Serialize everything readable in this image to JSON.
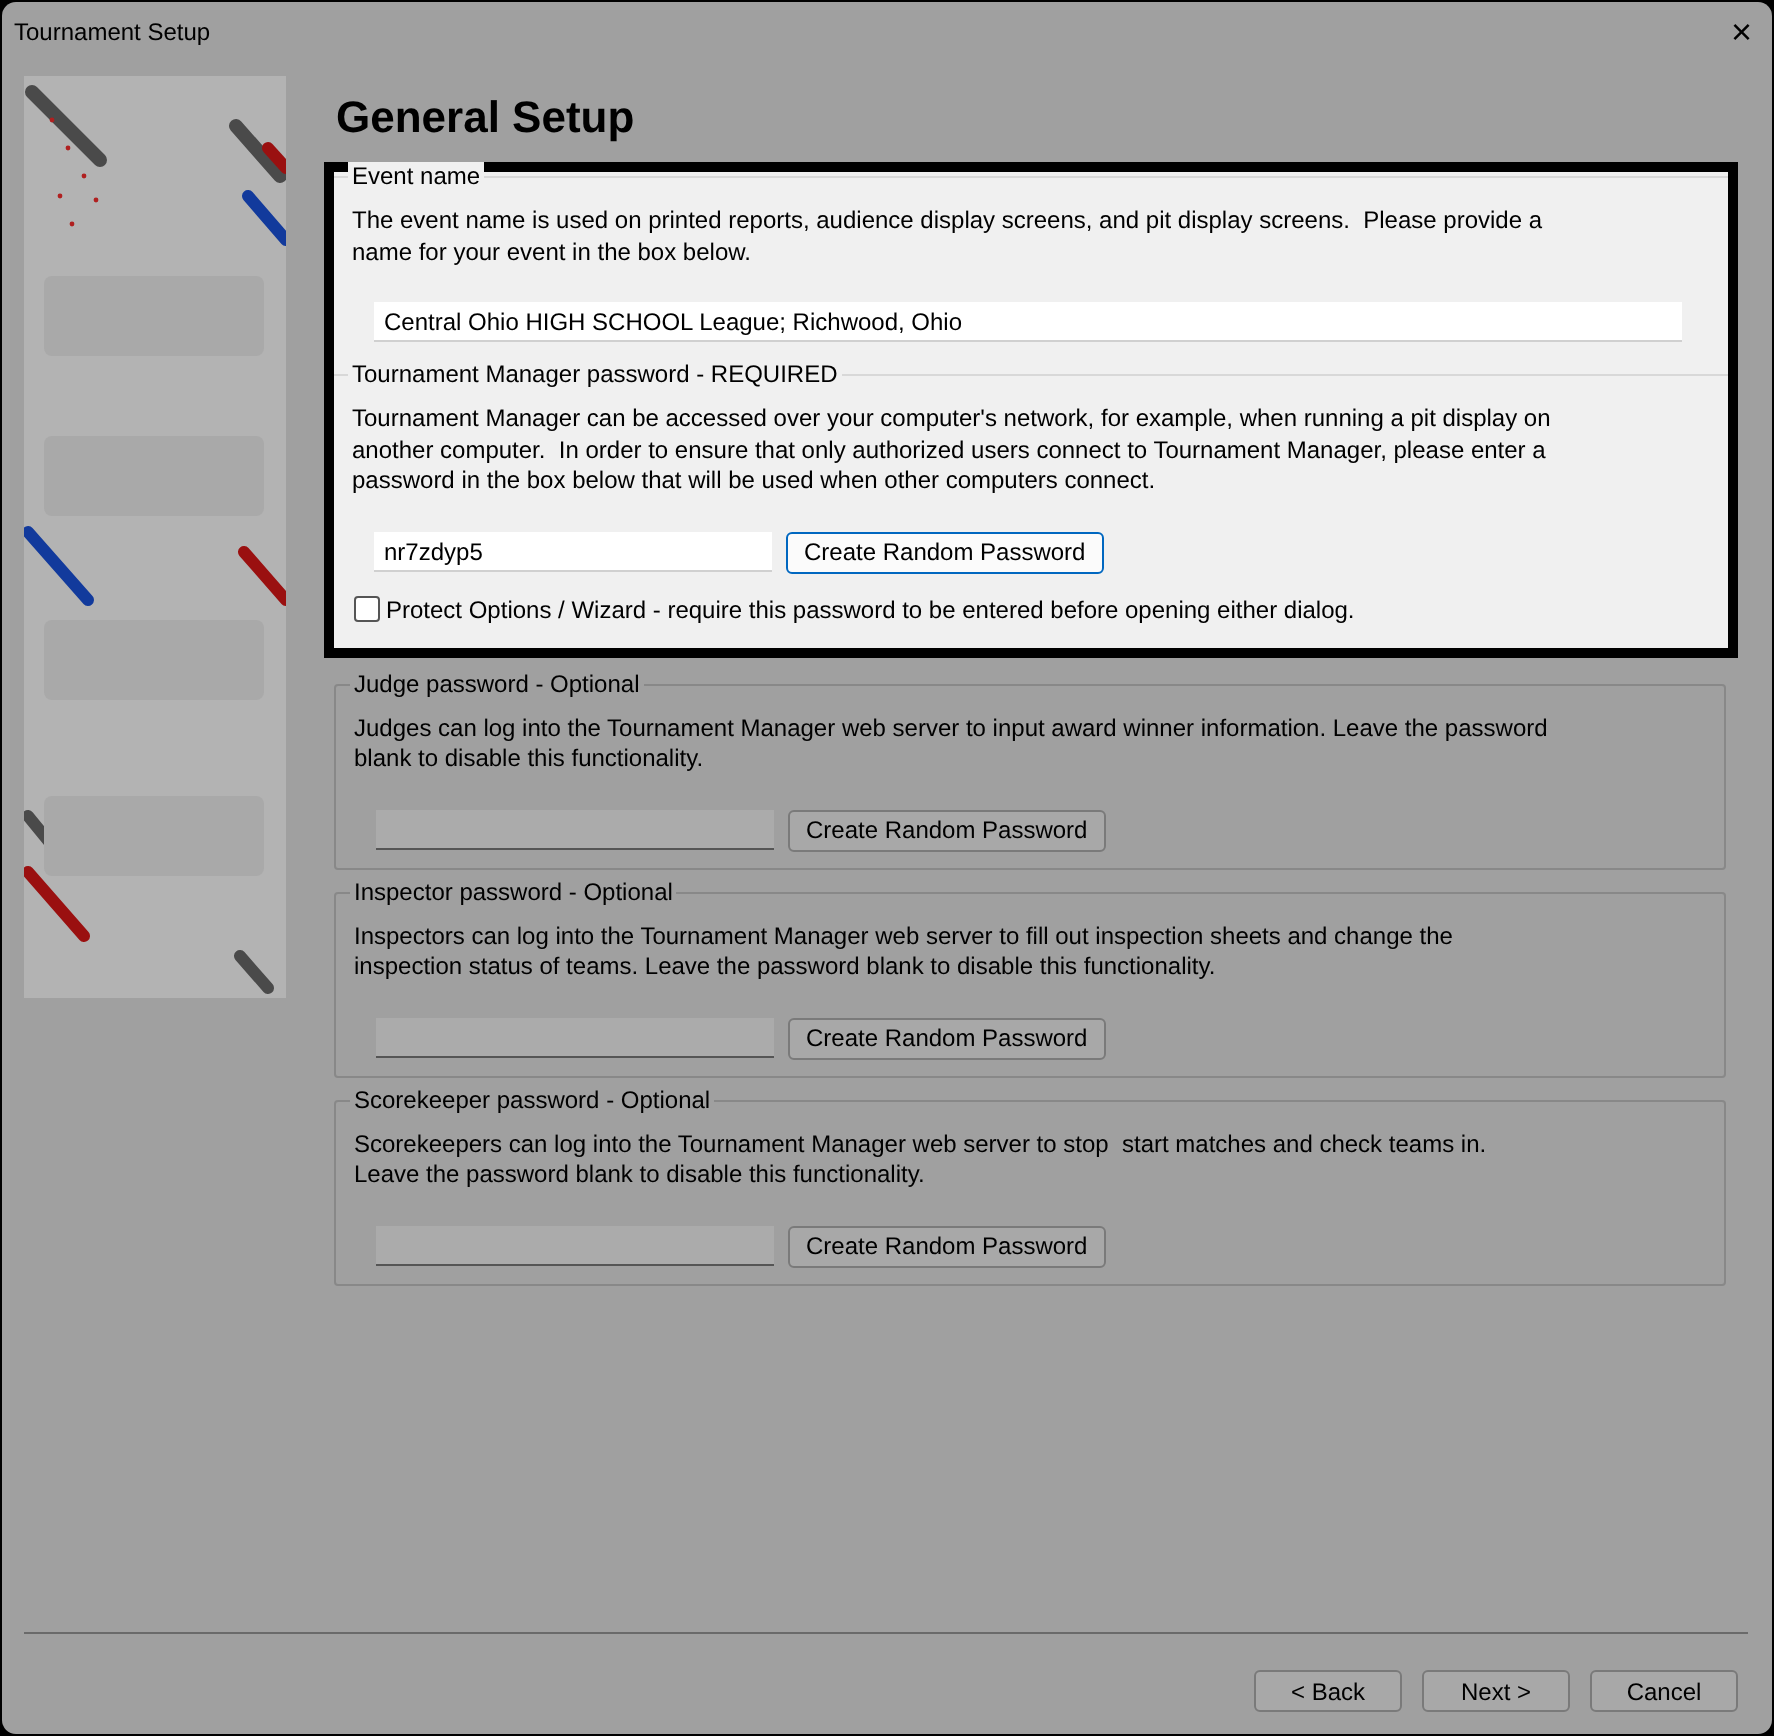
{
  "window": {
    "title": "Tournament Setup",
    "close": "×"
  },
  "heading": "General Setup",
  "sections": [
    {
      "title": "Event name",
      "highlighted": true,
      "description": "The event name is used on printed reports, audience display screens, and pit display screens.  Please provide a name for your event in the box below.",
      "field": {
        "kind": "wide",
        "value": "Central Ohio HIGH SCHOOL League; Richwood, Ohio"
      }
    },
    {
      "title": "Tournament Manager password - REQUIRED",
      "highlighted": true,
      "description": "Tournament Manager can be accessed over your computer's network, for example, when running a pit display on another computer.  In order to ensure that only authorized users connect to Tournament Manager, please enter a password in the box below that will be used when other computers connect.",
      "field": {
        "kind": "password",
        "value": "nr7zdyp5"
      },
      "button": {
        "label": "Create Random Password",
        "focused": true
      },
      "option": {
        "label": "Protect Options / Wizard - require this password to be entered before opening either dialog.",
        "checked": false
      }
    },
    {
      "title": "Judge password - Optional",
      "highlighted": false,
      "description": "Judges can log into the Tournament Manager web server to input award winner information. Leave the password blank to disable this functionality.",
      "field": {
        "kind": "password"
      },
      "button": {
        "label": "Create Random Password",
        "focused": false
      }
    },
    {
      "title": "Inspector password - Optional",
      "highlighted": false,
      "description": "Inspectors can log into the Tournament Manager web server to fill out inspection sheets and change the inspection status of teams. Leave the password blank to disable this functionality.",
      "field": {
        "kind": "password"
      },
      "button": {
        "label": "Create Random Password",
        "focused": false
      }
    },
    {
      "title": "Scorekeeper password - Optional",
      "highlighted": false,
      "description": "Scorekeepers can log into the Tournament Manager web server to stop  start matches and check teams in.\nLeave the password blank to disable this functionality.",
      "field": {
        "kind": "password"
      },
      "button": {
        "label": "Create Random Password",
        "focused": false
      }
    }
  ],
  "footer_buttons": [
    "< Back",
    "Next >",
    "Cancel"
  ]
}
